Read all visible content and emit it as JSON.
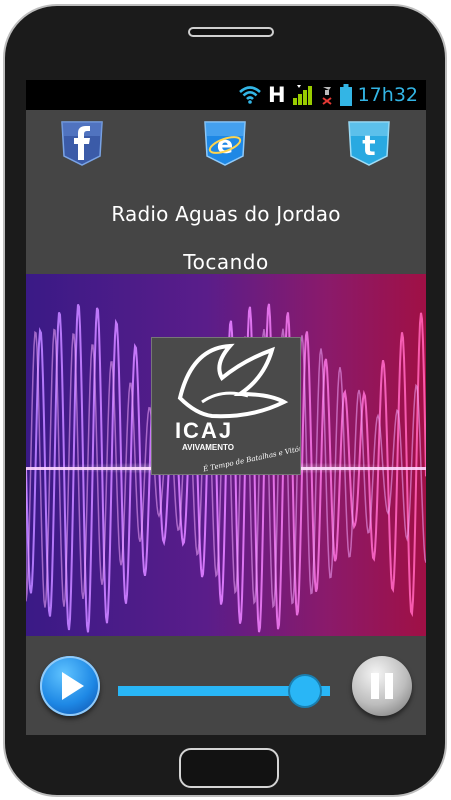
{
  "status_bar": {
    "time": "17h32",
    "network_label": "H",
    "icons": [
      "wifi-icon",
      "signal-icon",
      "no-sim-icon",
      "battery-icon"
    ]
  },
  "social": {
    "facebook_icon": "facebook-icon",
    "internet_explorer_icon": "internet-explorer-icon",
    "twitter_icon": "twitter-icon"
  },
  "station": {
    "name": "Radio Aguas do Jordao",
    "status": "Tocando"
  },
  "logo": {
    "primary_text": "ICAJ",
    "secondary_text": "AVIVAMENTO",
    "tagline": "É Tempo de Batalhas e Vitórias"
  },
  "player": {
    "play_icon": "play-icon",
    "pause_icon": "pause-icon",
    "volume_fraction": 0.88
  },
  "colors": {
    "accent": "#33b5e5",
    "screen_bg": "#454545",
    "wave_left": "#4a1f8f",
    "wave_right": "#b0124f"
  }
}
